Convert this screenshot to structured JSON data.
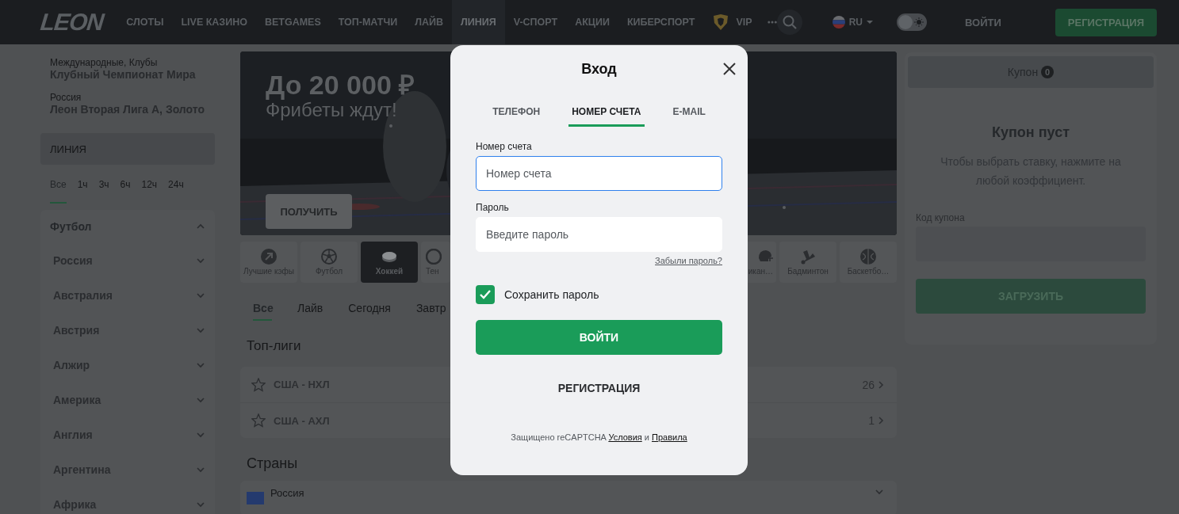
{
  "header": {
    "logo": "LEON",
    "nav": [
      {
        "label": "СЛОТЫ",
        "selected": false,
        "kind": "plain"
      },
      {
        "label": "LIVE КАЗИНО",
        "selected": false,
        "kind": "plain"
      },
      {
        "label": "BETGAMES",
        "selected": false,
        "kind": "plain"
      },
      {
        "label": "ТОП-МАТЧИ",
        "selected": false,
        "kind": "plain"
      },
      {
        "label": "ЛАЙВ",
        "selected": false,
        "kind": "plain"
      },
      {
        "label": "ЛИНИЯ",
        "selected": true,
        "kind": "plain"
      },
      {
        "label": "V-СПОРТ",
        "selected": false,
        "kind": "plain"
      },
      {
        "label": "АКЦИИ",
        "selected": false,
        "kind": "plain"
      },
      {
        "label": "КИБЕРСПОРТ",
        "selected": false,
        "kind": "plain"
      },
      {
        "label": "VIP",
        "selected": false,
        "kind": "vip"
      }
    ],
    "language": "RU",
    "theme_toggle": {
      "on": false
    },
    "login": "ВОЙТИ",
    "register": "РЕГИСТРАЦИЯ"
  },
  "sidebar": {
    "recent": [
      {
        "category": "Международные, Клубы",
        "name": "Клубный Чемпионат Мира"
      },
      {
        "category": "Россия",
        "name": "Леон Вторая Лига А, Золото"
      }
    ],
    "section": "ЛИНИЯ",
    "time_filters": [
      {
        "label": "Все",
        "selected": true
      },
      {
        "label": "1ч",
        "selected": false
      },
      {
        "label": "3ч",
        "selected": false
      },
      {
        "label": "6ч",
        "selected": false
      },
      {
        "label": "12ч",
        "selected": false
      },
      {
        "label": "24ч",
        "selected": false
      }
    ],
    "sports": [
      {
        "name": "Футбол",
        "expanded": true,
        "children": [
          {
            "name": "Россия",
            "expanded": false
          },
          {
            "name": "Австралия",
            "expanded": false
          },
          {
            "name": "Австрия",
            "expanded": false
          },
          {
            "name": "Алжир",
            "expanded": false
          },
          {
            "name": "Америка",
            "expanded": false
          },
          {
            "name": "Англия",
            "expanded": false
          },
          {
            "name": "Аргентина",
            "expanded": false
          },
          {
            "name": "Африка",
            "expanded": false
          }
        ]
      }
    ]
  },
  "banner": {
    "kind": "picture",
    "title": "До 20 000 ₽",
    "subtitle": "Фрибеты ждут!",
    "button": "ПОЛУЧИТЬ"
  },
  "sport_tiles": [
    {
      "label": "Лучшие кэфы",
      "kind": "best",
      "selected": false
    },
    {
      "label": "Футбол",
      "kind": "football",
      "selected": false
    },
    {
      "label": "Хоккей",
      "kind": "hockey",
      "selected": true
    },
    {
      "label": "Тен",
      "kind": "tennis",
      "selected": false
    },
    {
      "label": "икан…",
      "kind": "american-football",
      "selected": false
    },
    {
      "label": "Бадминтон",
      "kind": "badminton",
      "selected": false
    },
    {
      "label": "Баскетбо…",
      "kind": "basketball",
      "selected": false
    }
  ],
  "filter_tabs": [
    {
      "label": "Все",
      "selected": true
    },
    {
      "label": "Лайв",
      "selected": false
    },
    {
      "label": "Сегодня",
      "selected": false
    },
    {
      "label": "Завтр",
      "selected": false
    }
  ],
  "top_leagues": {
    "title": "Топ-лиги",
    "rows": [
      {
        "name": "США - НХЛ",
        "count": "26",
        "favorite": false
      },
      {
        "name": "США - АХЛ",
        "count": "1",
        "favorite": false
      }
    ]
  },
  "countries": {
    "title": "Страны",
    "rows": [
      {
        "name": "Россия"
      }
    ]
  },
  "coupon": {
    "tab": "Купон",
    "count": "0",
    "empty_title": "Купон пуст",
    "empty_text": "Чтобы выбрать ставку, нажмите на любой коэффициент.",
    "code_label": "Код купона",
    "load_button": "ЗАГРУЗИТЬ",
    "load_disabled": true
  },
  "login_modal": {
    "title": "Вход",
    "tabs": [
      {
        "label": "ТЕЛЕФОН",
        "selected": false
      },
      {
        "label": "НОМЕР СЧЕТА",
        "selected": true
      },
      {
        "label": "E-MAIL",
        "selected": false
      }
    ],
    "account_label": "Номер счета",
    "account_placeholder": "Номер счета",
    "account_focused": true,
    "password_label": "Пароль",
    "password_placeholder": "Введите пароль",
    "forgot": "Забыли пароль?",
    "remember": {
      "label": "Сохранить пароль",
      "checked": true
    },
    "submit": "ВОЙТИ",
    "register": "РЕГИСТРАЦИЯ",
    "recaptcha": {
      "text": "Защищено reCAPTCHA",
      "terms": "Условия",
      "and": "и",
      "privacy": "Правила"
    }
  }
}
